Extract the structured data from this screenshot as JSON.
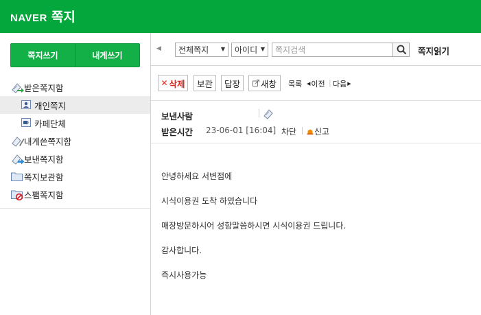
{
  "header": {
    "brand": "NAVER",
    "service": "쪽지"
  },
  "sidebar": {
    "compose_label": "쪽지쓰기",
    "self_label": "내게쓰기",
    "folders": [
      {
        "label": "받은쪽지함",
        "icon": "inbox-icon"
      },
      {
        "label": "개인쪽지",
        "icon": "person-icon"
      },
      {
        "label": "카페단체",
        "icon": "cafe-icon"
      },
      {
        "label": "내게쓴쪽지함",
        "icon": "self-note-icon"
      },
      {
        "label": "보낸쪽지함",
        "icon": "sent-icon"
      },
      {
        "label": "쪽지보관함",
        "icon": "folder-icon"
      },
      {
        "label": "스팸쪽지함",
        "icon": "spam-icon"
      }
    ]
  },
  "filter": {
    "scope_selected": "전체쪽지",
    "field_selected": "아이디",
    "search_placeholder": "쪽지검색",
    "page_title": "쪽지읽기"
  },
  "actions": {
    "delete_label": "삭제",
    "save_label": "보관",
    "reply_label": "답장",
    "newwin_label": "새창",
    "list_label": "목록",
    "prev_label": "이전",
    "next_label": "다음"
  },
  "message": {
    "sender_label": "보낸사람",
    "received_label": "받은시간",
    "received_time": "23-06-01 [16:04]",
    "block_label": "차단",
    "report_label": "신고",
    "lines": [
      "안녕하세요 서변점에",
      "시식이용권 도착 하였습니다",
      "매장방문하시어 성함말씀하시면 시식이용권 드립니다.",
      "감사합니다.",
      "즉시사용가능"
    ]
  },
  "colors": {
    "brand_green": "#03a73c",
    "button_green": "#13b047",
    "delete_red": "#e2271c"
  }
}
